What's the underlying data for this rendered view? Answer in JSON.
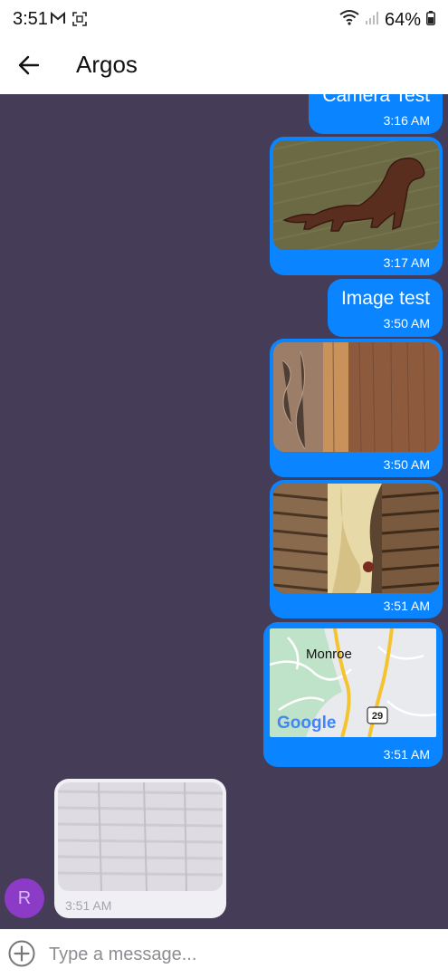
{
  "status": {
    "time": "3:51",
    "battery": "64%",
    "icons": [
      "gmail-icon",
      "screenshot-icon",
      "wifi-icon",
      "signal-icon",
      "battery-icon"
    ]
  },
  "header": {
    "title": "Argos",
    "back_icon": "arrow-left-icon"
  },
  "messages": [
    {
      "type": "text",
      "text": "Camera Test",
      "time": "3:16 AM",
      "direction": "outgoing"
    },
    {
      "type": "image",
      "image": "dog-embroidery-photo",
      "time": "3:17 AM",
      "direction": "outgoing"
    },
    {
      "type": "text",
      "text": "Image test",
      "time": "3:50 AM",
      "direction": "outgoing"
    },
    {
      "type": "image",
      "image": "wood-grain-photo",
      "time": "3:50 AM",
      "direction": "outgoing"
    },
    {
      "type": "image",
      "image": "wood-shutters-photo",
      "time": "3:51 AM",
      "direction": "outgoing"
    },
    {
      "type": "map",
      "map_place": "Monroe",
      "map_route": "29",
      "map_brand": "Google",
      "time": "3:51 AM",
      "direction": "outgoing"
    },
    {
      "type": "image",
      "image": "faded-shutters-photo",
      "time": "3:51 AM",
      "direction": "incoming"
    }
  ],
  "avatar": {
    "initial": "R",
    "color": "#8c3bc7"
  },
  "input": {
    "placeholder": "Type a message...",
    "value": ""
  },
  "colors": {
    "chat_background": "#453d57",
    "outgoing_bubble": "#0a84ff",
    "incoming_bubble": "#f0eff4"
  }
}
